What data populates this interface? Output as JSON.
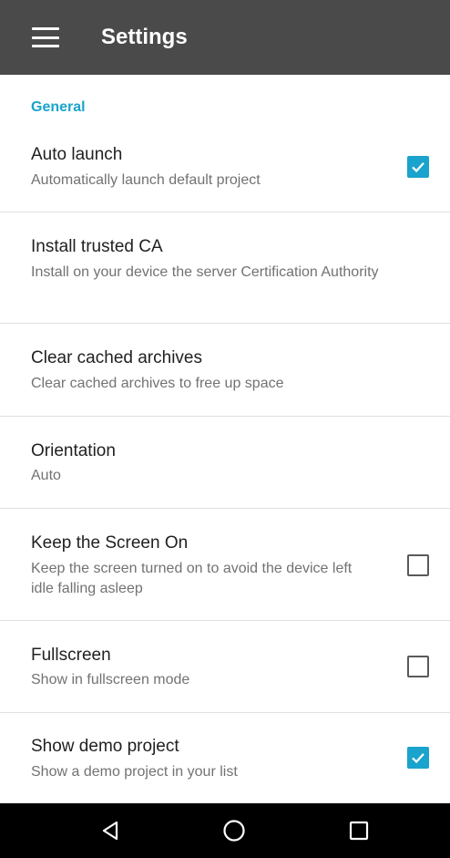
{
  "appbar": {
    "title": "Settings",
    "menu_icon": "hamburger-menu-icon"
  },
  "accent_color": "#1aa3cc",
  "section": {
    "title": "General"
  },
  "prefs": [
    {
      "title": "Auto launch",
      "summary": "Automatically launch default project",
      "checkbox": "checked"
    },
    {
      "title": "Install trusted CA",
      "summary": "Install on your device the server Certification Authority"
    },
    {
      "title": "Clear cached archives",
      "summary": "Clear cached archives to free up space"
    },
    {
      "title": "Orientation",
      "summary": "Auto"
    },
    {
      "title": "Keep the Screen On",
      "summary": "Keep the screen turned on to avoid the device left idle falling asleep",
      "checkbox": "unchecked"
    },
    {
      "title": "Fullscreen",
      "summary": "Show in fullscreen mode",
      "checkbox": "unchecked"
    },
    {
      "title": "Show demo project",
      "summary": "Show a demo project in your list",
      "checkbox": "checked"
    }
  ],
  "navbar": {
    "back_icon": "back-triangle-icon",
    "home_icon": "home-circle-icon",
    "recents_icon": "recents-square-icon"
  }
}
